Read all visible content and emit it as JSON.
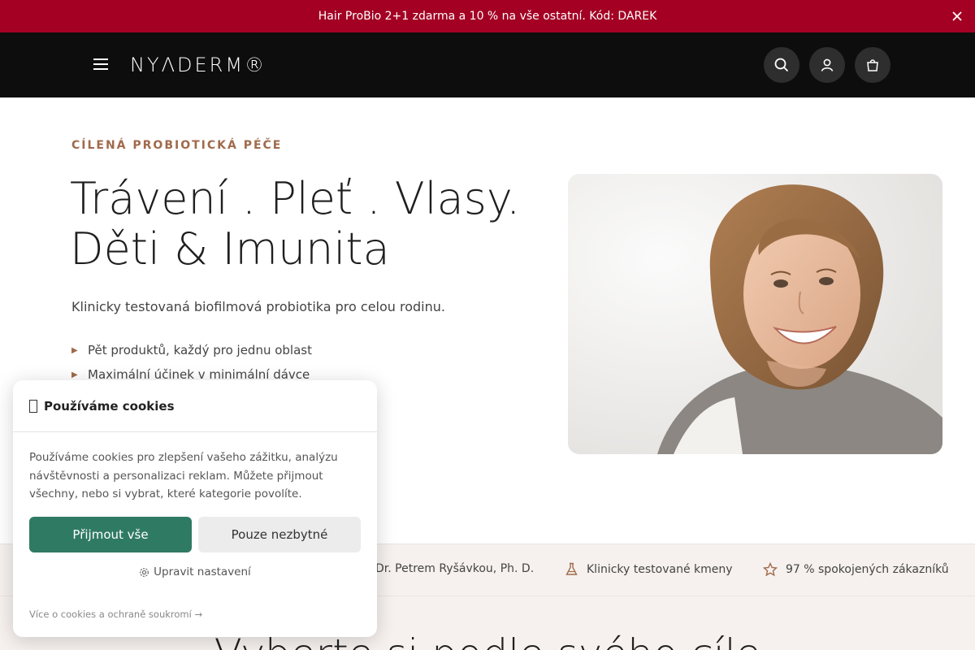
{
  "promo": {
    "text": "Hair ProBio 2+1 zdarma a 10 % na vše ostatní. Kód: DAREK",
    "close_icon": "close-icon",
    "background": "#a30023"
  },
  "header": {
    "logo": "NYΛDERM®",
    "menu_icon": "hamburger-icon",
    "search_icon": "search-icon",
    "account_icon": "user-icon",
    "cart_icon": "shopping-bag-icon",
    "background": "#0d0d0d"
  },
  "hero": {
    "eyebrow": "CÍLENÁ PROBIOTICKÁ PÉČE",
    "title_line1": "Trávení . Pleť . Vlasy.",
    "title_line2": "Děti & Imunita",
    "subtitle": "Klinicky testovaná biofilmová probiotika pro celou rodinu.",
    "bullets": [
      "Pět produktů, každý pro jednu oblast",
      "Maximální účinek v minimální dávce"
    ],
    "accent": "#a06a4b"
  },
  "trust": {
    "items": [
      {
        "label": "Dr. Petrem Ryšávkou, Ph. D."
      },
      {
        "label": "Klinicky testované kmeny",
        "icon": "flask-icon"
      },
      {
        "label": "97 % spokojených zákazníků",
        "icon": "star-icon"
      }
    ]
  },
  "section": {
    "title": "Vyberte si podle svého cíle"
  },
  "cookies": {
    "title": "Používáme cookies",
    "text": "Používáme cookies pro zlepšení vašeho zážitku, analýzu návštěvnosti a personalizaci reklam. Můžete přijmout všechny, nebo si vybrat, které kategorie povolíte.",
    "accept_label": "Přijmout vše",
    "necessary_label": "Pouze nezbytné",
    "settings_label": "Upravit nastavení",
    "settings_icon": "gear-icon",
    "link_label": "Více o cookies a ochraně soukromí →",
    "accept_color": "#2f7a63"
  }
}
